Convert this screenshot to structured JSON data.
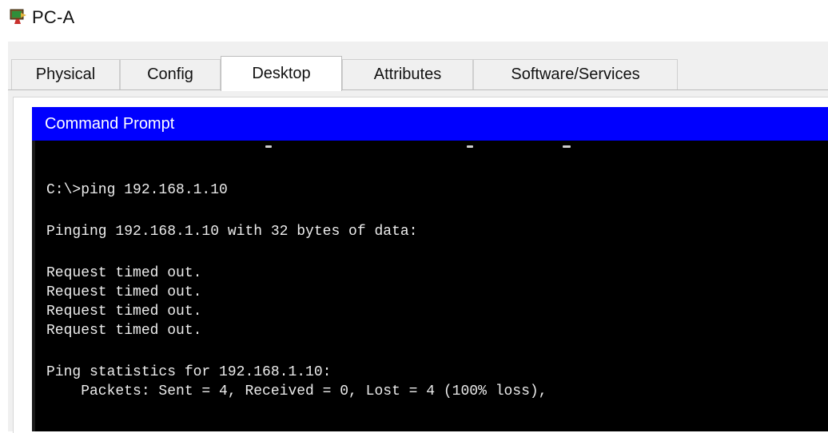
{
  "window": {
    "title": "PC-A",
    "icon": "pc-device-icon"
  },
  "tabs": [
    {
      "label": "Physical",
      "active": false
    },
    {
      "label": "Config",
      "active": false
    },
    {
      "label": "Desktop",
      "active": true
    },
    {
      "label": "Attributes",
      "active": false
    },
    {
      "label": "Software/Services",
      "active": false
    }
  ],
  "command_prompt": {
    "header": "Command Prompt",
    "header_color": "#0000ff",
    "lines": [
      "C:\\>ping 192.168.1.10",
      "Pinging 192.168.1.10 with 32 bytes of data:",
      "Request timed out.",
      "Request timed out.",
      "Request timed out.",
      "Request timed out.",
      "Ping statistics for 192.168.1.10:",
      "    Packets: Sent = 4, Received = 0, Lost = 4 (100% loss),"
    ]
  }
}
